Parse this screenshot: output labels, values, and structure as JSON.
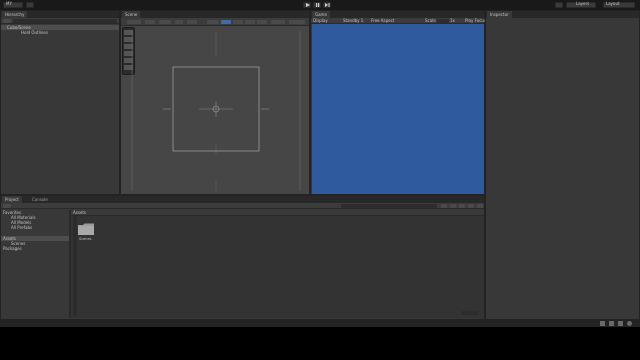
{
  "toolbar": {
    "account_label": "MY",
    "play_icon": "play-icon",
    "pause_icon": "pause-icon",
    "step_icon": "step-icon",
    "layers_label": "Layers",
    "layout_label": "Layout"
  },
  "hierarchy": {
    "tab_label": "Hierarchy",
    "items": [
      {
        "label": "Cube/Scene"
      },
      {
        "label": "Hold Outlines"
      }
    ]
  },
  "scene": {
    "tab_label": "Scene"
  },
  "game": {
    "tab_label": "Game",
    "display_label": "Display",
    "aspect_label": "Standby 1",
    "aspect_value": "Free Aspect",
    "scale_label": "Scale",
    "scale_value": "1x",
    "play_focused_label": "Play Focus",
    "background_color": "#2f5a9e"
  },
  "inspector": {
    "tab_label": "Inspector"
  },
  "project": {
    "tab_project": "Project",
    "tab_console": "Console",
    "tree": [
      {
        "label": "Favorites"
      },
      {
        "label": "All Materials"
      },
      {
        "label": "All Models"
      },
      {
        "label": "All Prefabs"
      },
      {
        "label": "Assets"
      },
      {
        "label": "Scenes"
      },
      {
        "label": "Packages"
      }
    ],
    "breadcrumb": "Assets",
    "assets": [
      {
        "label": "Scenes"
      }
    ]
  }
}
